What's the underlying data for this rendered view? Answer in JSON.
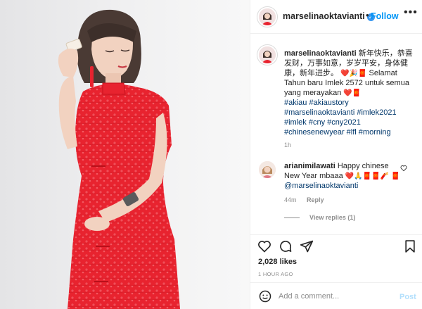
{
  "post": {
    "username": "marselinaoktavianti",
    "verified_icon": "verified-badge-icon",
    "follow_label": "Follow",
    "separator": "•",
    "more_label": "•••"
  },
  "caption": {
    "username": "marselinaoktavianti",
    "text_cn": "新年快乐，恭喜发财，万事如意，岁岁平安，身体健康，新年进步。",
    "emojis_1": "❤️🎉🧧",
    "text_id": "Selamat Tahun baru Imlek 2572 untuk semua yang merayakan",
    "emojis_2": "❤️🧧",
    "hashtags_line1": "#akiau #akiaustory",
    "hashtags_line2": "#marselinaoktavianti #imlek2021",
    "hashtags_line3": "#imlek #cny #cny2021",
    "hashtags_line4": "#chinesenewyear #lfl #morning",
    "time": "1h"
  },
  "comment": {
    "username": "arianimilawati",
    "text": "Happy chinese New Year mbaaa",
    "emojis": "❤️🙏🧧🧧🧨",
    "emoji_prefix": "🧧",
    "mention": "@marselinaoktavianti",
    "time": "44m",
    "reply_label": "Reply",
    "view_replies": "View replies (1)"
  },
  "actions": {
    "like_icon": "heart-icon",
    "comment_icon": "comment-icon",
    "share_icon": "share-icon",
    "save_icon": "bookmark-icon",
    "likes": "2,028 likes",
    "posted_ago": "1 HOUR AGO"
  },
  "add_comment": {
    "placeholder": "Add a comment...",
    "post_label": "Post"
  },
  "colors": {
    "accent": "#0095f6",
    "dress": "#e8232f",
    "text": "#262626",
    "muted": "#8e8e8e",
    "hashtag": "#00376b"
  }
}
